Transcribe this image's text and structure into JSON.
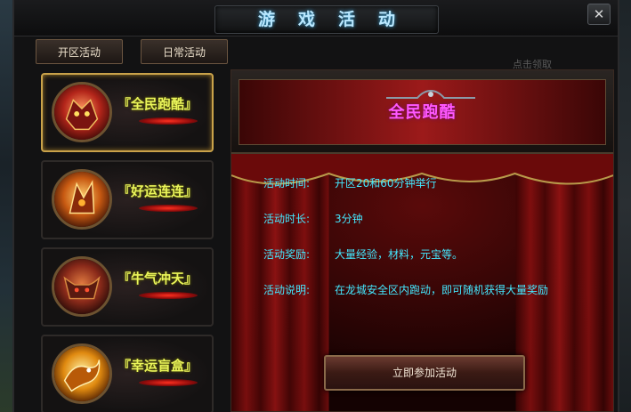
{
  "window": {
    "title": "游戏活动",
    "close_glyph": "✕"
  },
  "tabs": [
    {
      "label": "开区活动"
    },
    {
      "label": "日常活动"
    }
  ],
  "side_hint": "点击领取",
  "activities": [
    {
      "label": "『全民跑酷』",
      "icon": "red-dragon-head-icon",
      "orb_color": "#b3251a",
      "selected": true
    },
    {
      "label": "『好运连连』",
      "icon": "orange-dragon-icon",
      "orb_color": "#c85a12",
      "selected": false
    },
    {
      "label": "『牛气冲天』",
      "icon": "bull-head-icon",
      "orb_color": "#8a2a1a",
      "selected": false
    },
    {
      "label": "『幸运盲盒』",
      "icon": "golden-dragon-icon",
      "orb_color": "#e08a10",
      "selected": false
    }
  ],
  "detail": {
    "title": "全民跑酷",
    "rows": [
      {
        "key": "活动时间:",
        "value": "开区20和60分钟举行"
      },
      {
        "key": "活动时长:",
        "value": "3分钟"
      },
      {
        "key": "活动奖励:",
        "value": "大量经验，材料，元宝等。"
      },
      {
        "key": "活动说明:",
        "value": "在龙城安全区内跑动，即可随机获得大量奖励"
      }
    ],
    "join_label": "立即参加活动"
  },
  "colors": {
    "accent_text": "#44e8ff",
    "card_label": "#eaf55a",
    "detail_title": "#ff58ff",
    "selected_border": "#c9a24a"
  }
}
